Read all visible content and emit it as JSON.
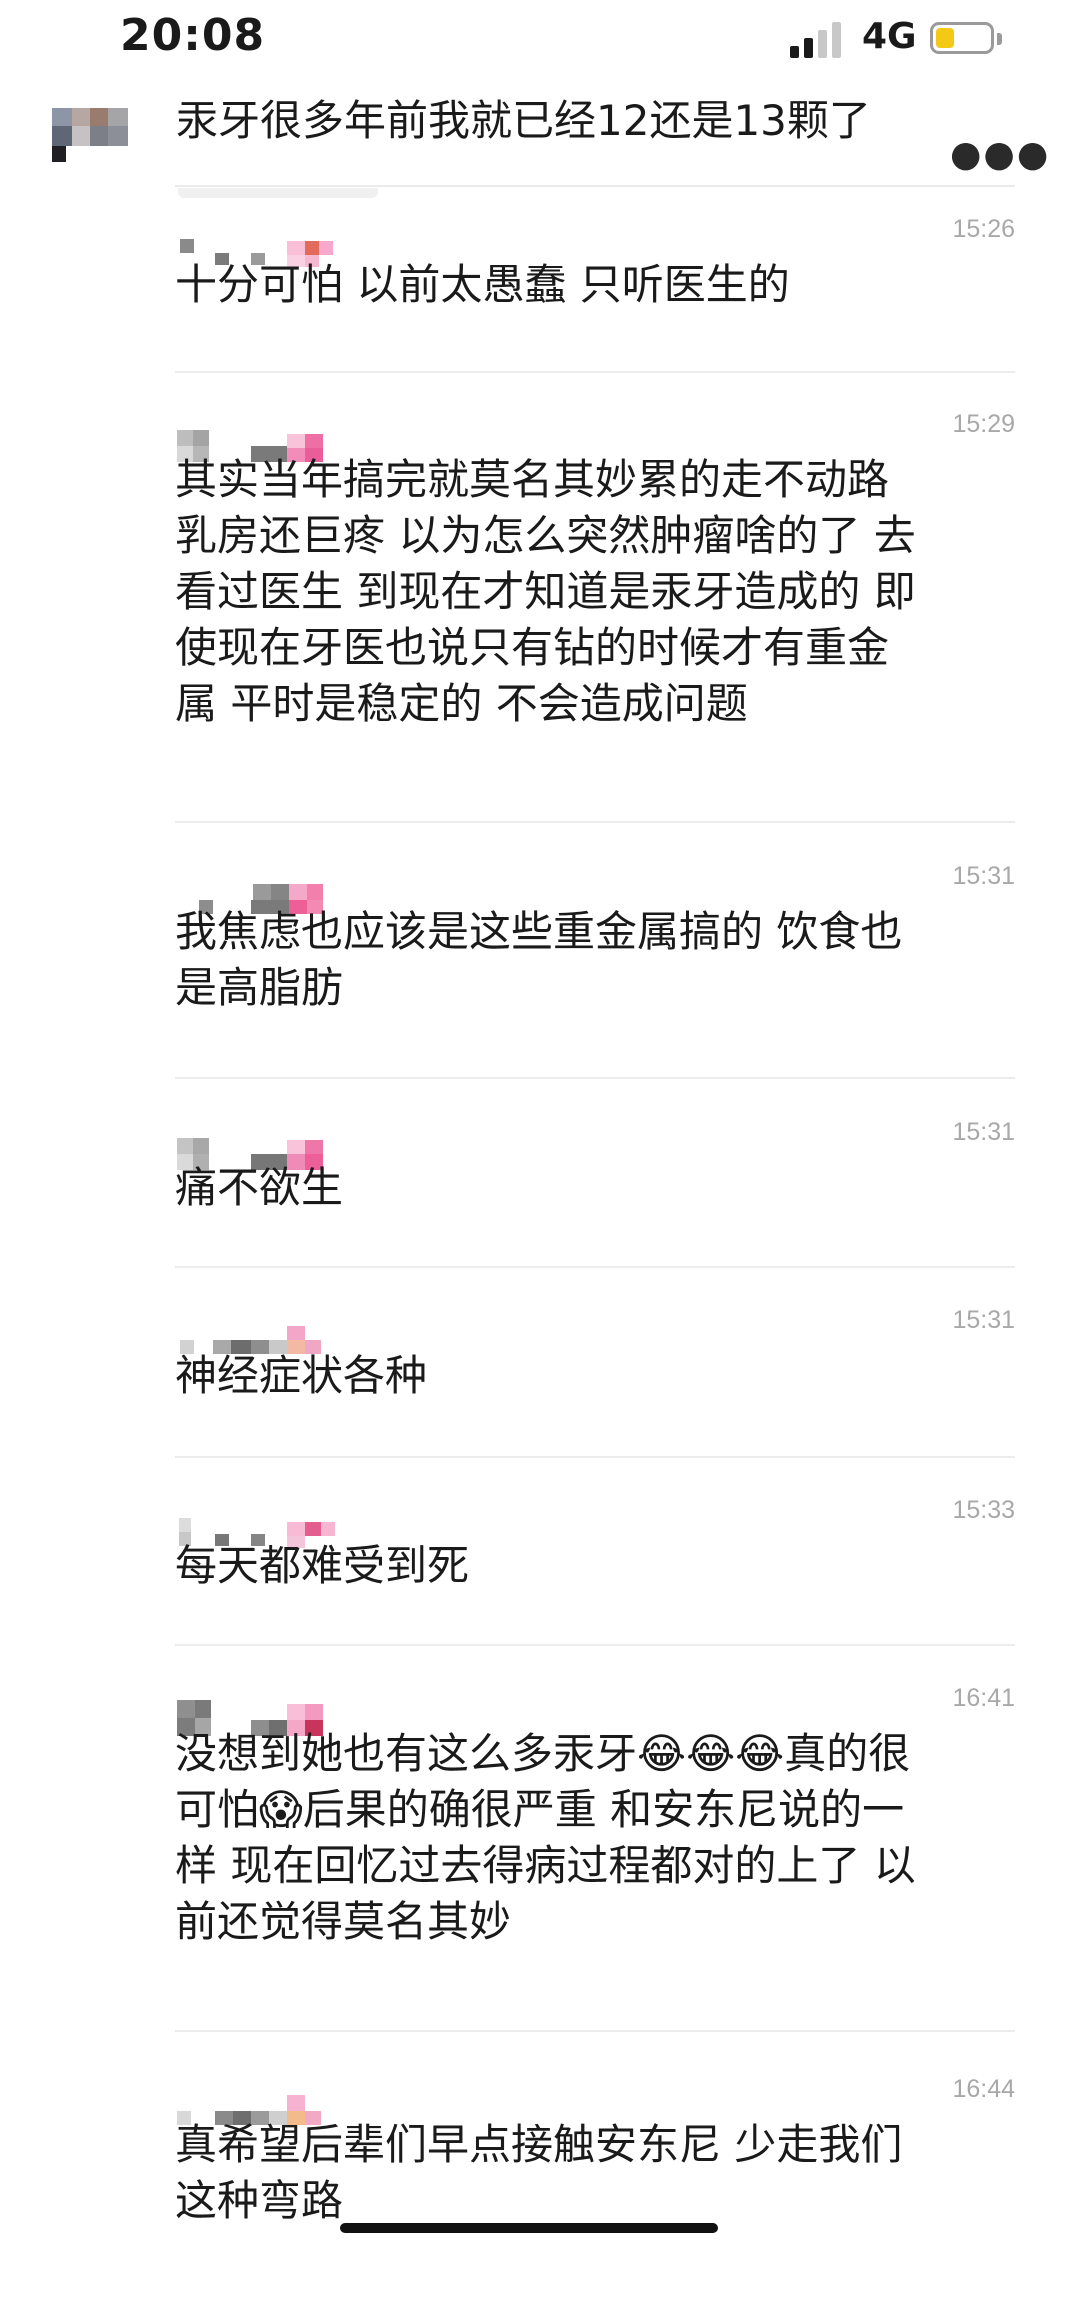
{
  "status_bar": {
    "time": "20:08",
    "network": "4G",
    "battery_level": 0.35,
    "battery_color": "#f3c915"
  },
  "top_message": {
    "text": "汞牙很多年前我就已经12还是13颗了",
    "more_icon": "more-dots-icon"
  },
  "comments": [
    {
      "time": "15:26",
      "text": "十分可怕 以前太愚蠢 只听医生的"
    },
    {
      "time": "15:29",
      "text": "其实当年搞完就莫名其妙累的走不动路\n乳房还巨疼 以为怎么突然肿瘤啥的了 去\n看过医生 到现在才知道是汞牙造成的 即\n使现在牙医也说只有钻的时候才有重金\n属 平时是稳定的 不会造成问题"
    },
    {
      "time": "15:31",
      "text": "我焦虑也应该是这些重金属搞的 饮食也\n是高脂肪"
    },
    {
      "time": "15:31",
      "text": "痛不欲生"
    },
    {
      "time": "15:31",
      "text": "神经症状各种"
    },
    {
      "time": "15:33",
      "text": "每天都难受到死"
    },
    {
      "time": "16:41",
      "text": "没想到她也有这么多汞牙😂😂😂真的很\n可怕😱后果的确很严重 和安东尼说的一\n样 现在回忆过去得病过程都对的上了 以\n前还觉得莫名其妙"
    },
    {
      "time": "16:44",
      "text": "真希望后辈们早点接触安东尼 少走我们\n这种弯路"
    }
  ]
}
